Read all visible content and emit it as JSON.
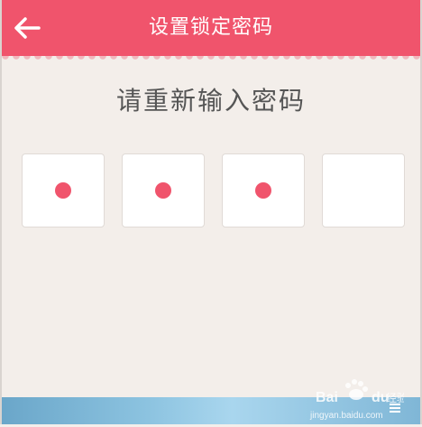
{
  "header": {
    "title": "设置锁定密码",
    "back_icon": "arrow-left-icon"
  },
  "prompt": {
    "text": "请重新输入密码"
  },
  "pin": {
    "length": 4,
    "filled": 3,
    "dot_color": "#f0546c"
  },
  "colors": {
    "header": "#f0546c",
    "background": "#f3eeea",
    "keyboard_edge": "#8cc3e0"
  },
  "watermark": {
    "brand": "Bai du 经验",
    "url": "jingyan.baidu.com"
  }
}
